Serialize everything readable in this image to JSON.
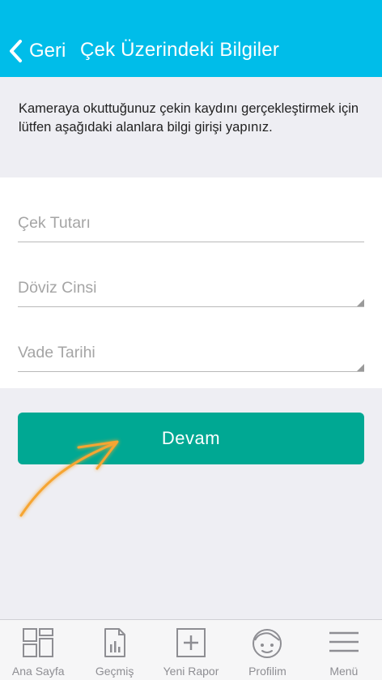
{
  "header": {
    "back_label": "Geri",
    "title": "Çek Üzerindeki Bilgiler"
  },
  "info": {
    "text": "Kameraya okuttuğunuz çekin kaydını gerçekleştirmek için lütfen aşağıdaki alanlara bilgi girişi yapınız."
  },
  "form": {
    "fields": [
      {
        "placeholder": "Çek Tutarı",
        "type": "text"
      },
      {
        "placeholder": "Döviz Cinsi",
        "type": "select"
      },
      {
        "placeholder": "Vade Tarihi",
        "type": "select"
      }
    ]
  },
  "button": {
    "label": "Devam"
  },
  "tabbar": {
    "items": [
      {
        "label": "Ana Sayfa",
        "icon": "grid-icon"
      },
      {
        "label": "Geçmiş",
        "icon": "history-chart-icon"
      },
      {
        "label": "Yeni Rapor",
        "icon": "plus-square-icon"
      },
      {
        "label": "Profilim",
        "icon": "profile-face-icon"
      },
      {
        "label": "Menü",
        "icon": "hamburger-menu-icon"
      }
    ]
  },
  "colors": {
    "header": "#00bde9",
    "button": "#00a893",
    "annotation_arrow": "#f6a531"
  }
}
